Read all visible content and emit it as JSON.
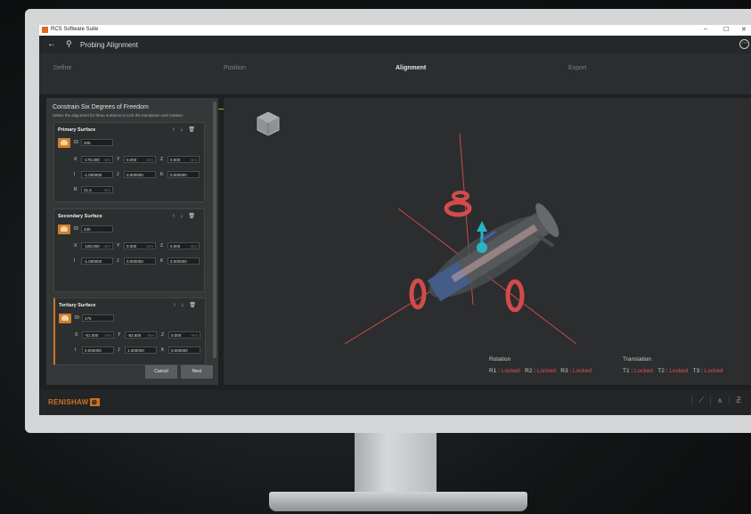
{
  "window": {
    "title": "RCS Software Suite",
    "minimize": "–",
    "maximize": "☐",
    "close": "✕"
  },
  "header": {
    "back": "←",
    "title": "Probing Alignment",
    "more": "⋯"
  },
  "stepper": {
    "steps": [
      {
        "label": "Define",
        "state": "done"
      },
      {
        "label": "Position",
        "state": "done"
      },
      {
        "label": "Alignment",
        "state": "active"
      },
      {
        "label": "Export",
        "state": "pending"
      }
    ],
    "accent": "#7ac143"
  },
  "panel": {
    "heading": "Constrain Six Degrees of Freedom",
    "subheading": "Select the alignment for three surfaces to lock the translation and rotation.",
    "surfaces": [
      {
        "title": "Primary Surface",
        "id_label": "ID",
        "id": "405",
        "x": "-170.300",
        "y": "0.000",
        "z": "0.000",
        "unit": "mm",
        "i": "-1.000000",
        "j": "0.000000",
        "k": "0.000000",
        "r_label": "R",
        "r": "31.5",
        "r_unit": "mm"
      },
      {
        "title": "Secondary Surface",
        "id_label": "ID",
        "id": "430",
        "x": "-100.000",
        "y": "0.000",
        "z": "0.000",
        "unit": "mm",
        "i": "-1.000000",
        "j": "0.000000",
        "k": "0.000000"
      },
      {
        "title": "Tertiary Surface",
        "id_label": "ID",
        "id": "475",
        "x": "-51.000",
        "y": "-82.500",
        "z": "0.000",
        "unit": "mm",
        "i": "0.000000",
        "j": "1.000000",
        "k": "0.000000"
      }
    ],
    "axis_labels": {
      "x": "X",
      "y": "Y",
      "z": "Z",
      "i": "I",
      "j": "J",
      "k": "K"
    },
    "actions": {
      "up": "↑",
      "down": "↓",
      "delete": "🗑"
    },
    "cancel": "Cancel",
    "next": "Next"
  },
  "status": {
    "rotation_title": "Rotation",
    "translation_title": "Translation",
    "rotation": [
      {
        "k": "R1 :",
        "v": "Locked"
      },
      {
        "k": "R2 :",
        "v": "Locked"
      },
      {
        "k": "R3 :",
        "v": "Locked"
      }
    ],
    "translation": [
      {
        "k": "T1 :",
        "v": "Locked"
      },
      {
        "k": "T2 :",
        "v": "Locked"
      },
      {
        "k": "T3 :",
        "v": "Locked"
      }
    ],
    "locked_color": "#e25252"
  },
  "footer": {
    "brand": "RENISHAW",
    "brand_mark": "⊕",
    "brand_color": "#d0731f"
  }
}
